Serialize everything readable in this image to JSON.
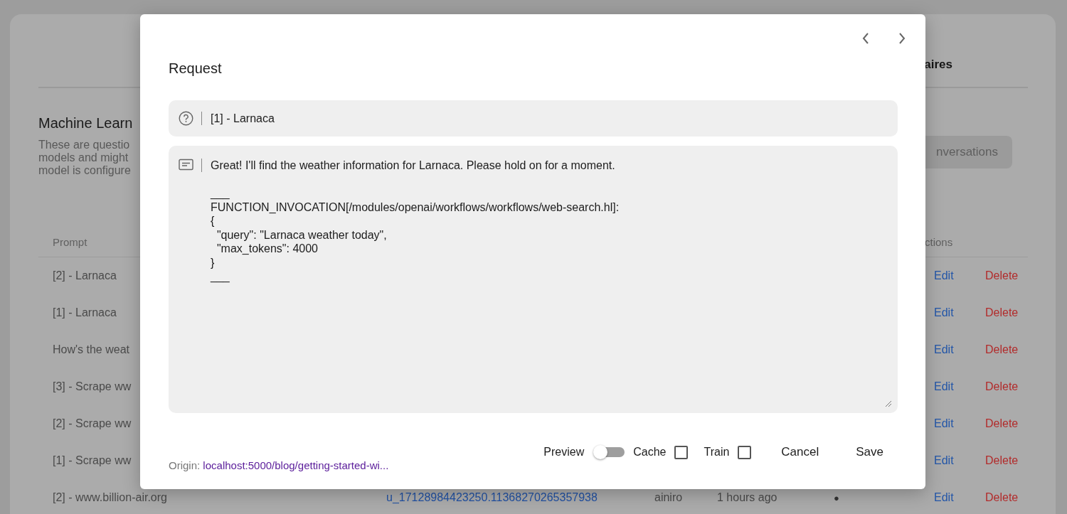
{
  "background": {
    "tab": "aires",
    "heading": "Machine Learn",
    "description": [
      "These are questio",
      "models and might",
      "model is configure"
    ],
    "button": "nversations",
    "table": {
      "columns": [
        "Prompt",
        "ctions"
      ],
      "rows": [
        {
          "prompt": "[2] - Larnaca",
          "edit": "Edit",
          "delete": "Delete"
        },
        {
          "prompt": "[1] - Larnaca",
          "edit": "Edit",
          "delete": "Delete"
        },
        {
          "prompt": "How's the weat",
          "edit": "Edit",
          "delete": "Delete"
        },
        {
          "prompt": "[3] - Scrape ww",
          "edit": "Edit",
          "delete": "Delete"
        },
        {
          "prompt": "[2] - Scrape ww",
          "edit": "Edit",
          "delete": "Delete"
        },
        {
          "prompt": "[1] - Scrape ww",
          "edit": "Edit",
          "delete": "Delete"
        },
        {
          "prompt": "[2] - www.billion-air.org",
          "column_2": "u_17128984423250.11368270265357938",
          "column_3": "ainiro",
          "column_4": "1 hours ago",
          "column_5": "●",
          "edit": "Edit",
          "delete": "Delete"
        }
      ]
    }
  },
  "dialog": {
    "title": "Request",
    "prompt": "[1] - Larnaca",
    "completion": "Great! I'll find the weather information for Larnaca. Please hold on for a moment.\n\n___\nFUNCTION_INVOCATION[/modules/openai/workflows/workflows/web-search.hl]:\n{\n  \"query\": \"Larnaca weather today\",\n  \"max_tokens\": 4000\n}\n___",
    "origin_label": "Origin:",
    "origin_link": "localhost:5000/blog/getting-started-wi...",
    "preview": {
      "label": "Preview",
      "on": false
    },
    "cache": {
      "label": "Cache",
      "checked": false
    },
    "train": {
      "label": "Train",
      "checked": false
    },
    "buttons": [
      "Cancel",
      "Save"
    ]
  }
}
